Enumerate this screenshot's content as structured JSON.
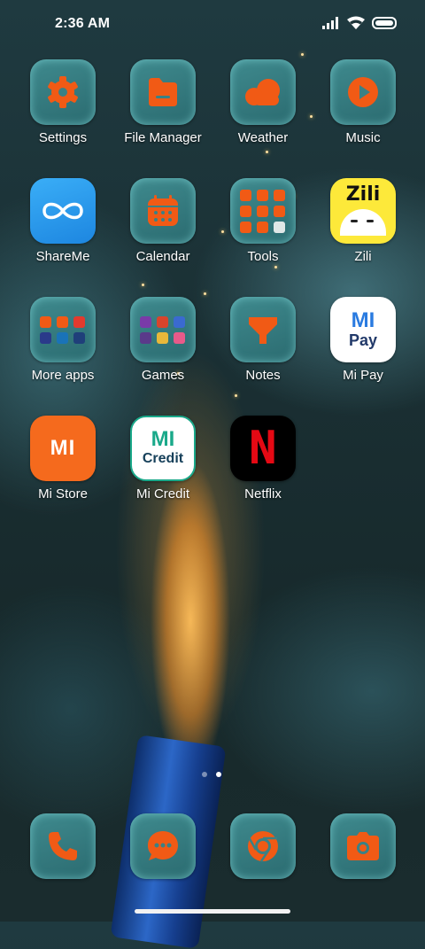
{
  "status": {
    "time": "2:36 AM",
    "icons": [
      "signal-icon",
      "wifi-icon",
      "battery-icon"
    ]
  },
  "colors": {
    "accent_orange": "#f15a15",
    "tile_teal": "#3a8185"
  },
  "apps": [
    {
      "label": "Settings",
      "icon": "gear-icon"
    },
    {
      "label": "File Manager",
      "icon": "folder-icon"
    },
    {
      "label": "Weather",
      "icon": "cloud-icon"
    },
    {
      "label": "Music",
      "icon": "play-icon"
    },
    {
      "label": "ShareMe",
      "icon": "infinity-icon"
    },
    {
      "label": "Calendar",
      "icon": "calendar-icon"
    },
    {
      "label": "Tools",
      "icon": "tools-folder-icon"
    },
    {
      "label": "Zili",
      "icon": "zili-icon",
      "icon_text": "Zili"
    },
    {
      "label": "More apps",
      "icon": "apps-folder-icon"
    },
    {
      "label": "Games",
      "icon": "games-folder-icon"
    },
    {
      "label": "Notes",
      "icon": "notes-icon"
    },
    {
      "label": "Mi Pay",
      "icon": "mipay-icon",
      "icon_text_top": "MI",
      "icon_text_bottom": "Pay"
    },
    {
      "label": "Mi Store",
      "icon": "mi-logo-icon",
      "icon_text": "MI"
    },
    {
      "label": "Mi Credit",
      "icon": "micredit-icon",
      "icon_text_top": "MI",
      "icon_text_bottom": "Credit"
    },
    {
      "label": "Netflix",
      "icon": "netflix-icon",
      "icon_text": "N"
    }
  ],
  "dock": [
    {
      "name": "phone",
      "icon": "phone-icon"
    },
    {
      "name": "messages",
      "icon": "message-icon"
    },
    {
      "name": "browser",
      "icon": "chrome-icon"
    },
    {
      "name": "camera",
      "icon": "camera-icon"
    }
  ],
  "pages": {
    "count": 2,
    "active": 2
  }
}
